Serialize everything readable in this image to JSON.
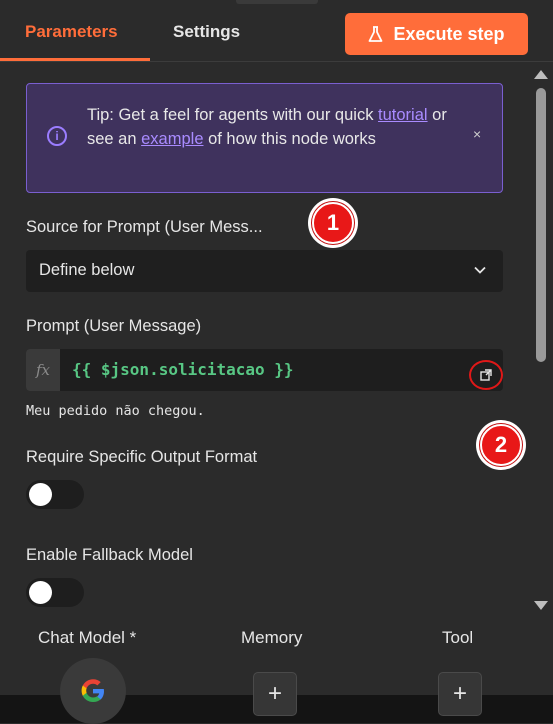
{
  "header": {
    "tabs": [
      {
        "label": "Parameters",
        "active": true
      },
      {
        "label": "Settings",
        "active": false
      }
    ],
    "execute_label": "Execute step",
    "accent": "#ff6d3a"
  },
  "tip": {
    "prefix": "Tip: Get a feel for agents with our quick ",
    "link1": "tutorial",
    "middle": " or see an ",
    "link2": "example",
    "suffix": " of how this node works",
    "icon": "info-icon",
    "close": "×"
  },
  "source": {
    "label": "Source for Prompt (User Mess...",
    "value": "Define below"
  },
  "prompt": {
    "label": "Prompt (User Message)",
    "fx": "fx",
    "expression": "{{ $json.solicitacao }}",
    "preview": "Meu pedido não chegou."
  },
  "output_format": {
    "label": "Require Specific Output Format",
    "enabled": false
  },
  "fallback": {
    "label": "Enable Fallback Model",
    "enabled": false
  },
  "annotations": {
    "badge1": "1",
    "badge2": "2",
    "badge_color": "#e81818"
  },
  "sub_nodes": {
    "chat_model": "Chat Model *",
    "memory": "Memory",
    "tool": "Tool",
    "add": "+"
  }
}
